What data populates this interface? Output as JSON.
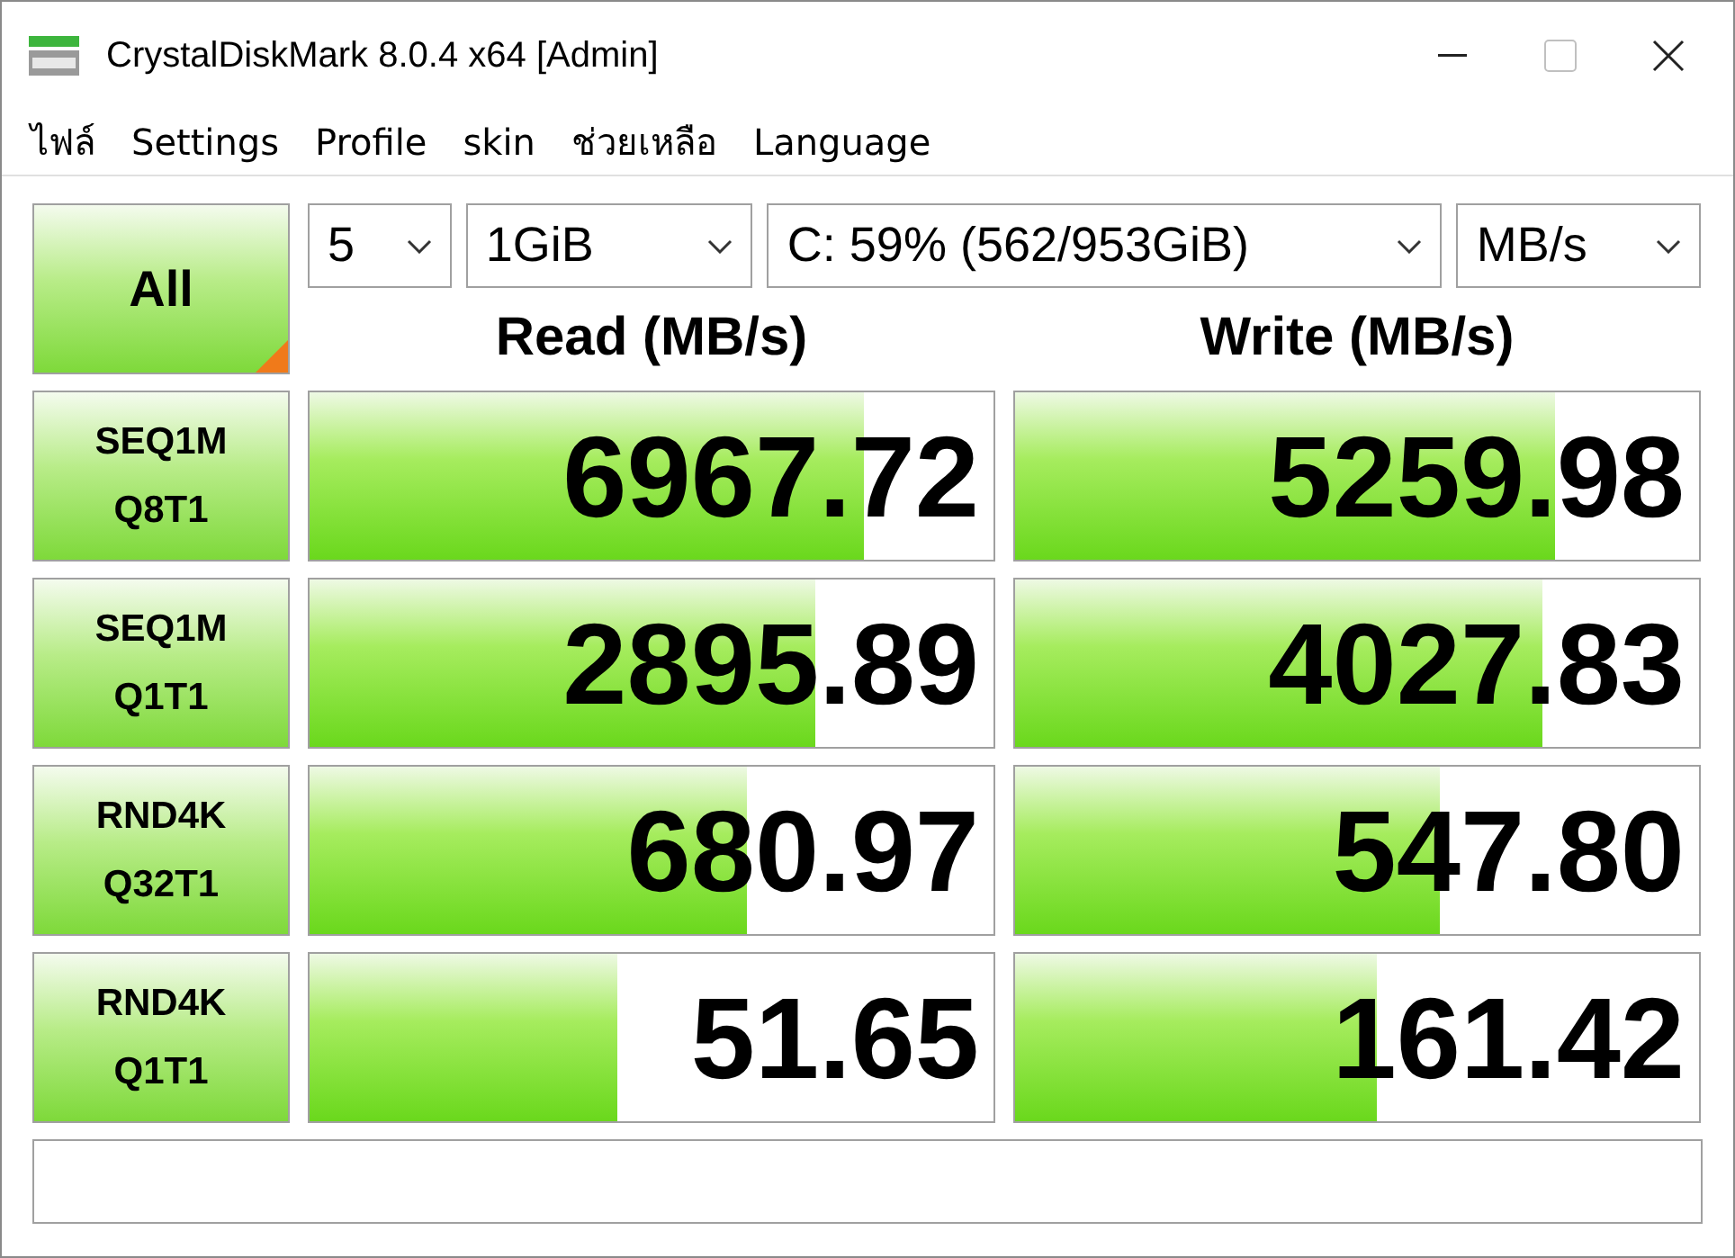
{
  "window": {
    "title": "CrystalDiskMark 8.0.4 x64 [Admin]"
  },
  "menu": [
    "ไฟล์",
    "Settings",
    "Profile",
    "skin",
    "ช่วยเหลือ",
    "Language"
  ],
  "all_button": "All",
  "selectors": [
    "5",
    "1GiB",
    "C: 59% (562/953GiB)",
    "MB/s"
  ],
  "headers": [
    "Read (MB/s)",
    "Write (MB/s)"
  ],
  "tests": [
    {
      "line1": "SEQ1M",
      "line2": "Q8T1",
      "read": {
        "value": "6967.72",
        "level": 0.81
      },
      "write": {
        "value": "5259.98",
        "level": 0.79
      }
    },
    {
      "line1": "SEQ1M",
      "line2": "Q1T1",
      "read": {
        "value": "2895.89",
        "level": 0.74
      },
      "write": {
        "value": "4027.83",
        "level": 0.77
      }
    },
    {
      "line1": "RND4K",
      "line2": "Q32T1",
      "read": {
        "value": "680.97",
        "level": 0.64
      },
      "write": {
        "value": "547.80",
        "level": 0.62
      }
    },
    {
      "line1": "RND4K",
      "line2": "Q1T1",
      "read": {
        "value": "51.65",
        "level": 0.45
      },
      "write": {
        "value": "161.42",
        "level": 0.53
      }
    }
  ]
}
